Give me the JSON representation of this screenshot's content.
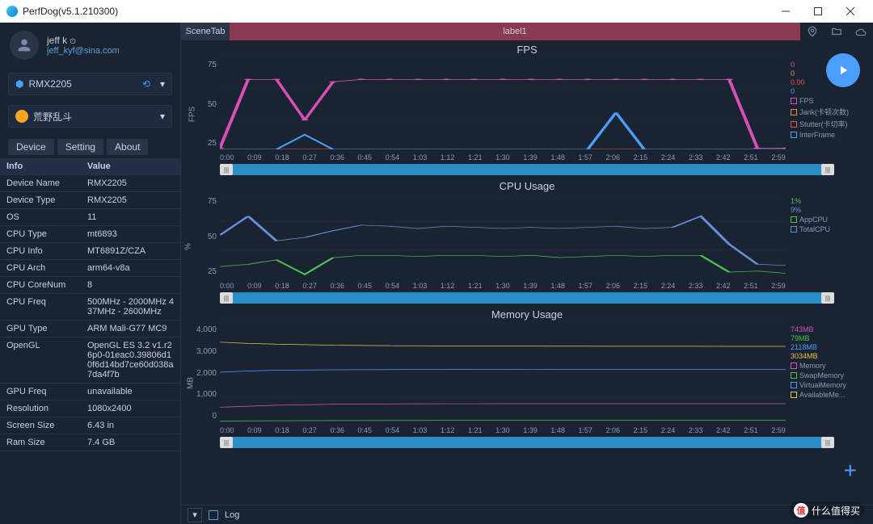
{
  "titlebar": {
    "title": "PerfDog(v5.1.210300)"
  },
  "user": {
    "name": "jeff k",
    "email": "jeff_kyf@sina.com"
  },
  "device_selector": "RMX2205",
  "app_selector": "荒野乱斗",
  "tabs": [
    "Device",
    "Setting",
    "About"
  ],
  "info": {
    "hdr_info": "Info",
    "hdr_value": "Value",
    "rows": [
      {
        "k": "Device Name",
        "v": "RMX2205"
      },
      {
        "k": "Device Type",
        "v": "RMX2205"
      },
      {
        "k": "OS",
        "v": "11"
      },
      {
        "k": "CPU Type",
        "v": "mt6893"
      },
      {
        "k": "CPU Info",
        "v": "MT6891Z/CZA"
      },
      {
        "k": "CPU Arch",
        "v": "arm64-v8a"
      },
      {
        "k": "CPU CoreNum",
        "v": "8"
      },
      {
        "k": "CPU Freq",
        "v": "500MHz - 2000MHz 437MHz - 2600MHz"
      },
      {
        "k": "GPU Type",
        "v": "ARM Mali-G77 MC9"
      },
      {
        "k": "OpenGL",
        "v": "OpenGL ES 3.2 v1.r26p0-01eac0.39806d10f6d14bd7ce60d038a7da4f7b"
      },
      {
        "k": "GPU Freq",
        "v": "unavailable"
      },
      {
        "k": "Resolution",
        "v": "1080x2400"
      },
      {
        "k": "Screen Size",
        "v": "6.43 in"
      },
      {
        "k": "Ram Size",
        "v": "7.4 GB"
      }
    ]
  },
  "scene": {
    "tab": "SceneTab",
    "label": "label1"
  },
  "bottom": {
    "log": "Log"
  },
  "watermark": "什么值得买",
  "chart_data": [
    {
      "type": "line",
      "title": "FPS",
      "ylabel": "FPS",
      "ylim": [
        0,
        75
      ],
      "yticks": [
        25,
        50,
        75
      ],
      "x_labels": [
        "0:00",
        "0:09",
        "0:18",
        "0:27",
        "0:36",
        "0:45",
        "0:54",
        "1:03",
        "1:12",
        "1:21",
        "1:30",
        "1:39",
        "1:48",
        "1:57",
        "2:06",
        "2:15",
        "2:24",
        "2:33",
        "2:42",
        "2:51",
        "2:59"
      ],
      "series": [
        {
          "name": "FPS",
          "color": "#d84fb5",
          "values": [
            1,
            57,
            57,
            24,
            55,
            57,
            57,
            57,
            57,
            57,
            57,
            57,
            57,
            57,
            57,
            57,
            57,
            57,
            57,
            1,
            1
          ]
        },
        {
          "name": "Jank(卡顿次数)",
          "color": "#f08c3a",
          "values": [
            0,
            0,
            0,
            0,
            0,
            0,
            0,
            0,
            0,
            0,
            0,
            0,
            0,
            0,
            0,
            0,
            0,
            0,
            0,
            0,
            0
          ]
        },
        {
          "name": "Stutter(卡切率)",
          "color": "#e8544a",
          "values": [
            0.0,
            0.0,
            0.0,
            0.0,
            0.0,
            0.0,
            0.0,
            0.0,
            0.0,
            0.0,
            0.0,
            0.0,
            0.0,
            0.0,
            0.0,
            0.0,
            0.0,
            0.0,
            0.0,
            0.0,
            0.0
          ]
        },
        {
          "name": "InterFrame",
          "color": "#4a9eff",
          "values": [
            0,
            0,
            0,
            12,
            0,
            0,
            0,
            0,
            0,
            0,
            0,
            0,
            0,
            0,
            30,
            0,
            0,
            0,
            0,
            0,
            0
          ]
        }
      ],
      "current_vals": [
        "0",
        "0",
        "0.00",
        "0"
      ]
    },
    {
      "type": "line",
      "title": "CPU Usage",
      "ylabel": "%",
      "ylim": [
        0,
        75
      ],
      "yticks": [
        25,
        50,
        75
      ],
      "x_labels": [
        "0:00",
        "0:09",
        "0:18",
        "0:27",
        "0:36",
        "0:45",
        "0:54",
        "1:03",
        "1:12",
        "1:21",
        "1:30",
        "1:39",
        "1:48",
        "1:57",
        "2:06",
        "2:15",
        "2:24",
        "2:33",
        "2:42",
        "2:51",
        "2:59"
      ],
      "series": [
        {
          "name": "AppCPU",
          "color": "#4fc24f",
          "values": [
            10,
            12,
            16,
            3,
            18,
            20,
            20,
            19,
            20,
            20,
            19,
            20,
            18,
            19,
            20,
            19,
            20,
            20,
            5,
            6,
            4
          ]
        },
        {
          "name": "TotalCPU",
          "color": "#6a8fd8",
          "values": [
            38,
            55,
            33,
            36,
            42,
            47,
            46,
            44,
            46,
            45,
            44,
            45,
            44,
            45,
            46,
            44,
            45,
            55,
            30,
            12,
            11
          ]
        }
      ],
      "current_vals": [
        "1%",
        "9%"
      ]
    },
    {
      "type": "line",
      "title": "Memory Usage",
      "ylabel": "MB",
      "ylim": [
        0,
        4000
      ],
      "yticks": [
        0,
        1000,
        2000,
        3000,
        4000
      ],
      "x_labels": [
        "0:00",
        "0:09",
        "0:18",
        "0:27",
        "0:36",
        "0:45",
        "0:54",
        "1:03",
        "1:12",
        "1:21",
        "1:30",
        "1:39",
        "1:48",
        "1:57",
        "2:06",
        "2:15",
        "2:24",
        "2:33",
        "2:42",
        "2:51",
        "2:59"
      ],
      "series": [
        {
          "name": "Memory",
          "color": "#d84fb5",
          "values": [
            600,
            640,
            680,
            700,
            720,
            730,
            735,
            738,
            740,
            740,
            741,
            742,
            742,
            742,
            743,
            743,
            743,
            743,
            743,
            743,
            743
          ]
        },
        {
          "name": "SwapMemory",
          "color": "#4fc24f",
          "values": [
            50,
            55,
            60,
            65,
            68,
            70,
            72,
            74,
            75,
            76,
            77,
            77,
            78,
            78,
            78,
            79,
            79,
            79,
            79,
            79,
            79
          ]
        },
        {
          "name": "VirtualMemory",
          "color": "#4a9eff",
          "values": [
            2000,
            2050,
            2080,
            2090,
            2095,
            2100,
            2105,
            2108,
            2110,
            2112,
            2114,
            2115,
            2116,
            2116,
            2117,
            2117,
            2118,
            2118,
            2118,
            2118,
            2118
          ]
        },
        {
          "name": "AvailableMe...",
          "color": "#e8c24a",
          "values": [
            3200,
            3150,
            3120,
            3100,
            3080,
            3070,
            3060,
            3055,
            3050,
            3048,
            3046,
            3044,
            3042,
            3040,
            3038,
            3036,
            3036,
            3035,
            3034,
            3034,
            3034
          ]
        }
      ],
      "current_vals": [
        "743MB",
        "79MB",
        "2118MB",
        "3034MB"
      ]
    }
  ]
}
